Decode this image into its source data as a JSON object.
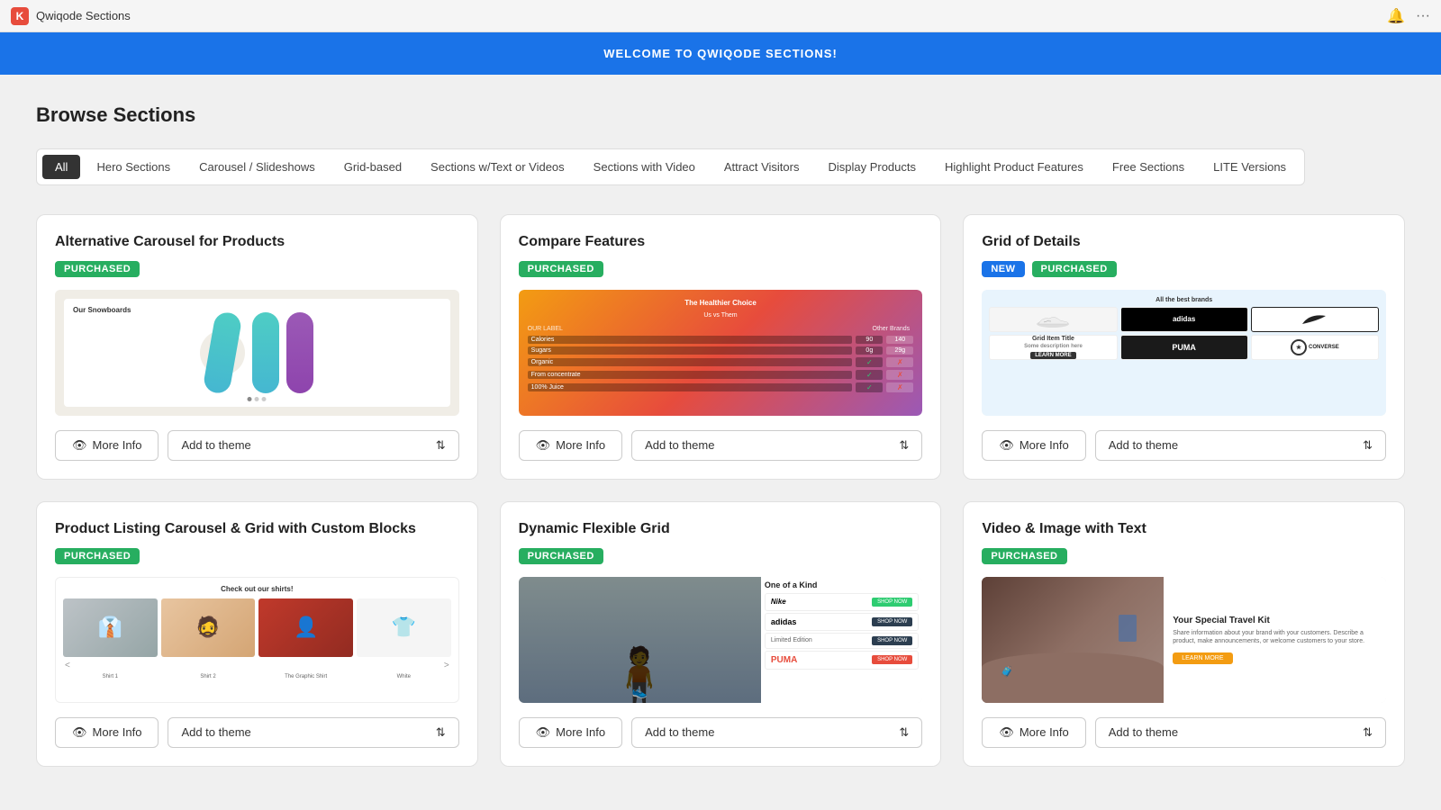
{
  "titlebar": {
    "app_name": "Qwiqode Sections",
    "logo_letter": "K"
  },
  "welcome_banner": {
    "text": "WELCOME TO QWIQODE SECTIONS!"
  },
  "main": {
    "browse_title": "Browse Sections",
    "filter_tabs": [
      {
        "id": "all",
        "label": "All",
        "active": true
      },
      {
        "id": "hero",
        "label": "Hero Sections"
      },
      {
        "id": "carousel",
        "label": "Carousel / Slideshows"
      },
      {
        "id": "grid",
        "label": "Grid-based"
      },
      {
        "id": "text-video",
        "label": "Sections w/Text or Videos"
      },
      {
        "id": "sections-video",
        "label": "Sections with Video"
      },
      {
        "id": "attract",
        "label": "Attract Visitors"
      },
      {
        "id": "display",
        "label": "Display Products"
      },
      {
        "id": "highlight",
        "label": "Highlight Product Features"
      },
      {
        "id": "free",
        "label": "Free Sections"
      },
      {
        "id": "lite",
        "label": "LITE Versions"
      }
    ],
    "cards": [
      {
        "id": "card-1",
        "title": "Alternative Carousel for Products",
        "badges": [
          {
            "label": "PURCHASED",
            "type": "purchased"
          }
        ],
        "more_info_label": "More Info",
        "add_theme_label": "Add to theme"
      },
      {
        "id": "card-2",
        "title": "Compare Features",
        "badges": [
          {
            "label": "PURCHASED",
            "type": "purchased"
          }
        ],
        "more_info_label": "More Info",
        "add_theme_label": "Add to theme"
      },
      {
        "id": "card-3",
        "title": "Grid of Details",
        "badges": [
          {
            "label": "NEW",
            "type": "new"
          },
          {
            "label": "PURCHASED",
            "type": "purchased"
          }
        ],
        "more_info_label": "More Info",
        "add_theme_label": "Add to theme"
      },
      {
        "id": "card-4",
        "title": "Product Listing Carousel & Grid with Custom Blocks",
        "badges": [
          {
            "label": "PURCHASED",
            "type": "purchased"
          }
        ],
        "more_info_label": "More Info",
        "add_theme_label": "Add to theme"
      },
      {
        "id": "card-5",
        "title": "Dynamic Flexible Grid",
        "badges": [
          {
            "label": "PURCHASED",
            "type": "purchased"
          }
        ],
        "more_info_label": "More Info",
        "add_theme_label": "Add to theme"
      },
      {
        "id": "card-6",
        "title": "Video & Image with Text",
        "badges": [
          {
            "label": "PURCHASED",
            "type": "purchased"
          }
        ],
        "more_info_label": "More Info",
        "add_theme_label": "Add to theme"
      }
    ]
  },
  "icons": {
    "eye": "👁",
    "chevron_up_down": "⇅",
    "bell": "🔔",
    "ellipsis": "···"
  }
}
